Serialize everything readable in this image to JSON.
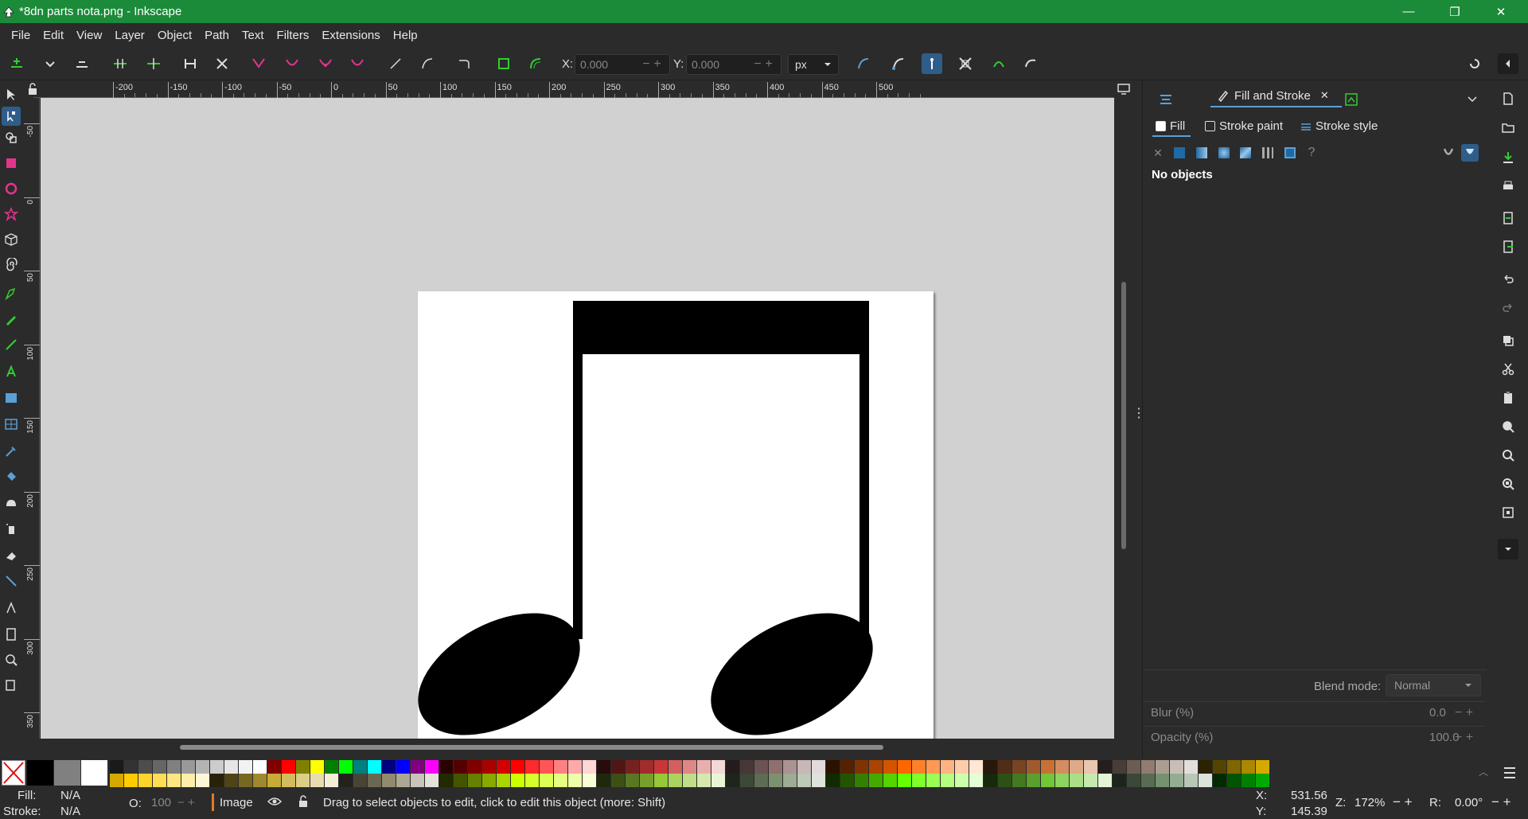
{
  "window": {
    "title": "*8dn parts nota.png - Inkscape",
    "minimize": "—",
    "maximize": "❐",
    "close": "✕"
  },
  "menu": [
    "File",
    "Edit",
    "View",
    "Layer",
    "Object",
    "Path",
    "Text",
    "Filters",
    "Extensions",
    "Help"
  ],
  "tool_controls": {
    "x_label": "X:",
    "x_value": "0.000",
    "y_label": "Y:",
    "y_value": "0.000",
    "unit": "px"
  },
  "ruler": {
    "h_ticks": [
      "-200",
      "-150",
      "-100",
      "-50",
      "0",
      "50",
      "100",
      "150",
      "200",
      "250",
      "300",
      "350",
      "400",
      "450",
      "500"
    ],
    "v_ticks": [
      "-50",
      "0",
      "50",
      "100",
      "150",
      "200",
      "250",
      "300",
      "350"
    ]
  },
  "panel": {
    "tab_fill_stroke": "Fill and Stroke",
    "sub_fill": "Fill",
    "sub_stroke_paint": "Stroke paint",
    "sub_stroke_style": "Stroke style",
    "no_objects": "No objects",
    "blend_label": "Blend mode:",
    "blend_value": "Normal",
    "blur_label": "Blur (%)",
    "blur_value": "0.0",
    "opacity_label": "Opacity (%)",
    "opacity_value": "100.0"
  },
  "palette": {
    "row1": [
      "#1a1a1a",
      "#333333",
      "#4d4d4d",
      "#666666",
      "#808080",
      "#999999",
      "#b3b3b3",
      "#cccccc",
      "#e6e6e6",
      "#f2f2f2",
      "#ffffff",
      "#800000",
      "#ff0000",
      "#808000",
      "#ffff00",
      "#008000",
      "#00ff00",
      "#008080",
      "#00ffff",
      "#000080",
      "#0000ff",
      "#800080",
      "#ff00ff",
      "#2b0000",
      "#550000",
      "#800000",
      "#aa0000",
      "#d40000",
      "#ff0000",
      "#ff2a2a",
      "#ff5555",
      "#ff8080",
      "#ffaaaa",
      "#ffd5d5",
      "#280b0b",
      "#501616",
      "#782121",
      "#a02c2c",
      "#c83737",
      "#d35f5f",
      "#de8787",
      "#e9afaf",
      "#f4d7d7",
      "#241c1c",
      "#483737",
      "#6c5353",
      "#916f6f",
      "#ac9393",
      "#c8b7b7",
      "#e3dbdb",
      "#2b1100",
      "#552200",
      "#803300",
      "#aa4400",
      "#d45500",
      "#ff6600",
      "#ff7f2a",
      "#ff9955",
      "#ffb380",
      "#ffccaa",
      "#ffe6d5",
      "#28170b",
      "#502d16",
      "#784421",
      "#a05a2c",
      "#c87137",
      "#d38d5f",
      "#deaa87",
      "#e9c6af",
      "#241f1c",
      "#483e37",
      "#6c5d53",
      "#917c6f",
      "#ac9d93",
      "#c8beb7",
      "#e3dedb",
      "#2b2200",
      "#554400",
      "#806600",
      "#aa8800",
      "#d4aa00"
    ],
    "row2": [
      "#d4aa00",
      "#ffcc00",
      "#ffd42a",
      "#ffdd55",
      "#ffe680",
      "#ffeeaa",
      "#fff6d5",
      "#28220b",
      "#504416",
      "#786721",
      "#a0892c",
      "#c8ab37",
      "#d3bc5f",
      "#decd87",
      "#e9ddaf",
      "#f4eed7",
      "#24221c",
      "#484537",
      "#6c6753",
      "#918a6f",
      "#aca793",
      "#c8c4b7",
      "#e3e2db",
      "#222b00",
      "#445500",
      "#668000",
      "#88aa00",
      "#aad400",
      "#ccff00",
      "#d4ff2a",
      "#ddff55",
      "#e5ff80",
      "#eeffaa",
      "#f6ffd5",
      "#1e280b",
      "#3c5016",
      "#5a7821",
      "#789f2c",
      "#96c837",
      "#abd35f",
      "#c0de87",
      "#d5e9af",
      "#eaf4d7",
      "#1f241c",
      "#3e4837",
      "#5d6c53",
      "#7c916f",
      "#9dac93",
      "#bec8b7",
      "#dee3db",
      "#112b00",
      "#225500",
      "#338000",
      "#44aa00",
      "#55d400",
      "#66ff00",
      "#7fff2a",
      "#99ff55",
      "#b3ff80",
      "#ccffaa",
      "#e5ffd5",
      "#17280b",
      "#2d5016",
      "#447821",
      "#5aa02c",
      "#71c837",
      "#8dd35f",
      "#aade87",
      "#c6e9af",
      "#e3f4d7",
      "#1d241c",
      "#3a4837",
      "#586c53",
      "#75916f",
      "#93ac93",
      "#b7c8b7",
      "#dbe3db",
      "#002b00",
      "#005500",
      "#008000",
      "#00aa00"
    ],
    "big": [
      "#000000",
      "#808080",
      "#ffffff"
    ]
  },
  "status": {
    "fill_label": "Fill:",
    "fill_value": "N/A",
    "stroke_label": "Stroke:",
    "stroke_value": "N/A",
    "o_label": "O:",
    "o_value": "100",
    "layer": "Image",
    "message": "Drag to select objects to edit, click to edit this object (more: Shift)",
    "x_label": "X:",
    "x_value": "531.56",
    "y_label": "Y:",
    "y_value": "145.39",
    "z_label": "Z:",
    "zoom": "172%",
    "r_label": "R:",
    "rotation": "0.00°"
  }
}
